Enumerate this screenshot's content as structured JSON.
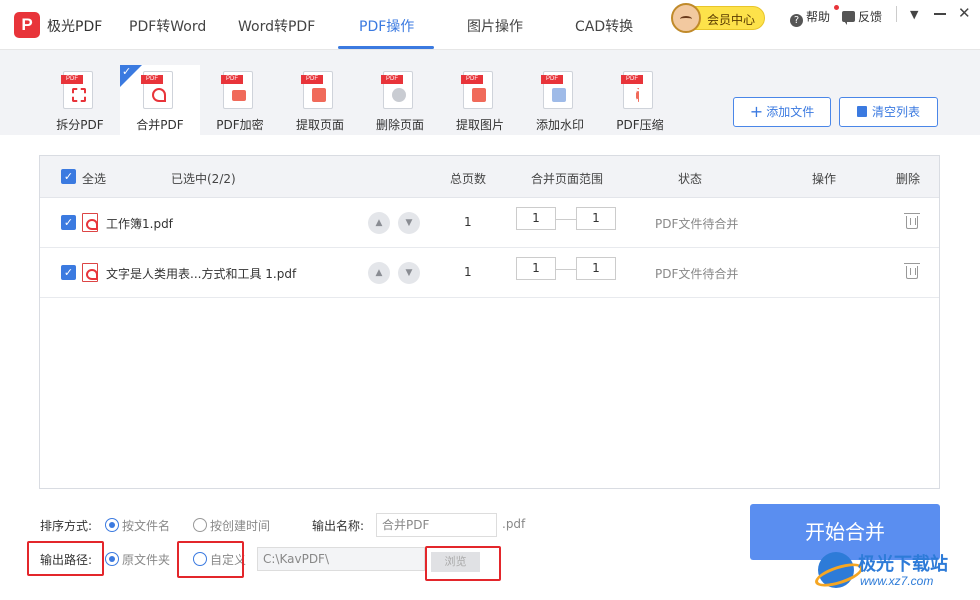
{
  "app": {
    "name": "极光PDF",
    "logo_letter": "P"
  },
  "nav": {
    "tabs": [
      {
        "label": "PDF转Word"
      },
      {
        "label": "Word转PDF"
      },
      {
        "label": "PDF操作",
        "active": true
      },
      {
        "label": "图片操作"
      },
      {
        "label": "CAD转换"
      }
    ]
  },
  "header": {
    "vip_label": "会员中心",
    "help_label": "帮助",
    "feedback_label": "反馈"
  },
  "tools": [
    {
      "label": "拆分PDF",
      "icon": "split-pdf-icon"
    },
    {
      "label": "合并PDF",
      "icon": "merge-pdf-icon",
      "active": true
    },
    {
      "label": "PDF加密",
      "icon": "encrypt-pdf-icon"
    },
    {
      "label": "提取页面",
      "icon": "extract-pages-icon"
    },
    {
      "label": "删除页面",
      "icon": "delete-pages-icon"
    },
    {
      "label": "提取图片",
      "icon": "extract-images-icon"
    },
    {
      "label": "添加水印",
      "icon": "watermark-icon"
    },
    {
      "label": "PDF压缩",
      "icon": "compress-pdf-icon"
    }
  ],
  "toolbar": {
    "add_file": "添加文件",
    "clear_list": "清空列表"
  },
  "table": {
    "select_all": "全选",
    "selected_count": "已选中(2/2)",
    "headers": {
      "pages": "总页数",
      "range": "合并页面范围",
      "status": "状态",
      "action": "操作",
      "delete": "删除"
    },
    "rows": [
      {
        "name": "工作簿1.pdf",
        "pages": "1",
        "range_from": "1",
        "range_to": "1",
        "status": "PDF文件待合并"
      },
      {
        "name": "文字是人类用表...方式和工具 1.pdf",
        "pages": "1",
        "range_from": "1",
        "range_to": "1",
        "status": "PDF文件待合并"
      }
    ]
  },
  "options": {
    "sort_label": "排序方式:",
    "sort_by_name": "按文件名",
    "sort_by_time": "按创建时间",
    "output_name_label": "输出名称:",
    "output_name_value": "合并PDF",
    "output_ext": ".pdf",
    "output_path_label": "输出路径:",
    "path_original": "原文件夹",
    "path_custom": "自定义",
    "path_value": "C:\\KavPDF\\",
    "browse": "浏览"
  },
  "start_button": "开始合并",
  "watermark": {
    "title": "极光下载站",
    "url": "www.xz7.com"
  },
  "colors": {
    "accent": "#3b7ae0",
    "logo_red": "#e8343a",
    "highlight_red": "#e3262b",
    "start_button": "#5a8ef0"
  }
}
